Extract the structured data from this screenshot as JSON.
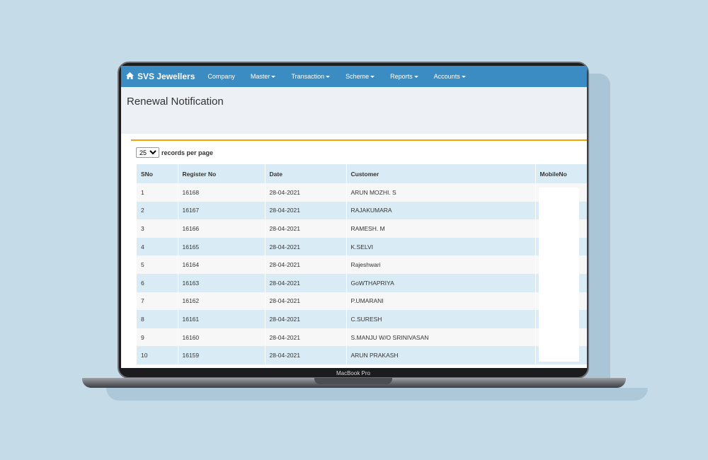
{
  "app": {
    "brand": "SVS Jewellers",
    "menu": [
      {
        "label": "Company",
        "dropdown": false
      },
      {
        "label": "Master",
        "dropdown": true
      },
      {
        "label": "Transaction",
        "dropdown": true
      },
      {
        "label": "Scheme",
        "dropdown": true
      },
      {
        "label": "Reports",
        "dropdown": true
      },
      {
        "label": "Accounts",
        "dropdown": true
      }
    ]
  },
  "page": {
    "title": "Renewal Notification",
    "page_size": "25",
    "records_label": "records per page"
  },
  "table": {
    "headers": [
      "SNo",
      "Register No",
      "Date",
      "Customer",
      "MobileNo"
    ],
    "rows": [
      [
        "1",
        "16168",
        "28-04-2021",
        "ARUN MOZHI. S",
        ""
      ],
      [
        "2",
        "16167",
        "28-04-2021",
        "RAJAKUMARA",
        ""
      ],
      [
        "3",
        "16166",
        "28-04-2021",
        "RAMESH. M",
        ""
      ],
      [
        "4",
        "16165",
        "28-04-2021",
        "K.SELVI",
        ""
      ],
      [
        "5",
        "16164",
        "28-04-2021",
        "Rajeshwari",
        ""
      ],
      [
        "6",
        "16163",
        "28-04-2021",
        "GoWTHAPRIYA",
        ""
      ],
      [
        "7",
        "16162",
        "28-04-2021",
        "P.UMARANI",
        ""
      ],
      [
        "8",
        "16161",
        "28-04-2021",
        "C.SURESH",
        ""
      ],
      [
        "9",
        "16160",
        "28-04-2021",
        "S.MANJU W/O SRINIVASAN",
        ""
      ],
      [
        "10",
        "16159",
        "28-04-2021",
        "ARUN PRAKASH",
        ""
      ]
    ]
  },
  "device": {
    "label": "MacBook Pro"
  },
  "colors": {
    "navbar": "#3b8cc2",
    "accent": "#f0a30a",
    "row_alt": "#d9ecf6"
  }
}
